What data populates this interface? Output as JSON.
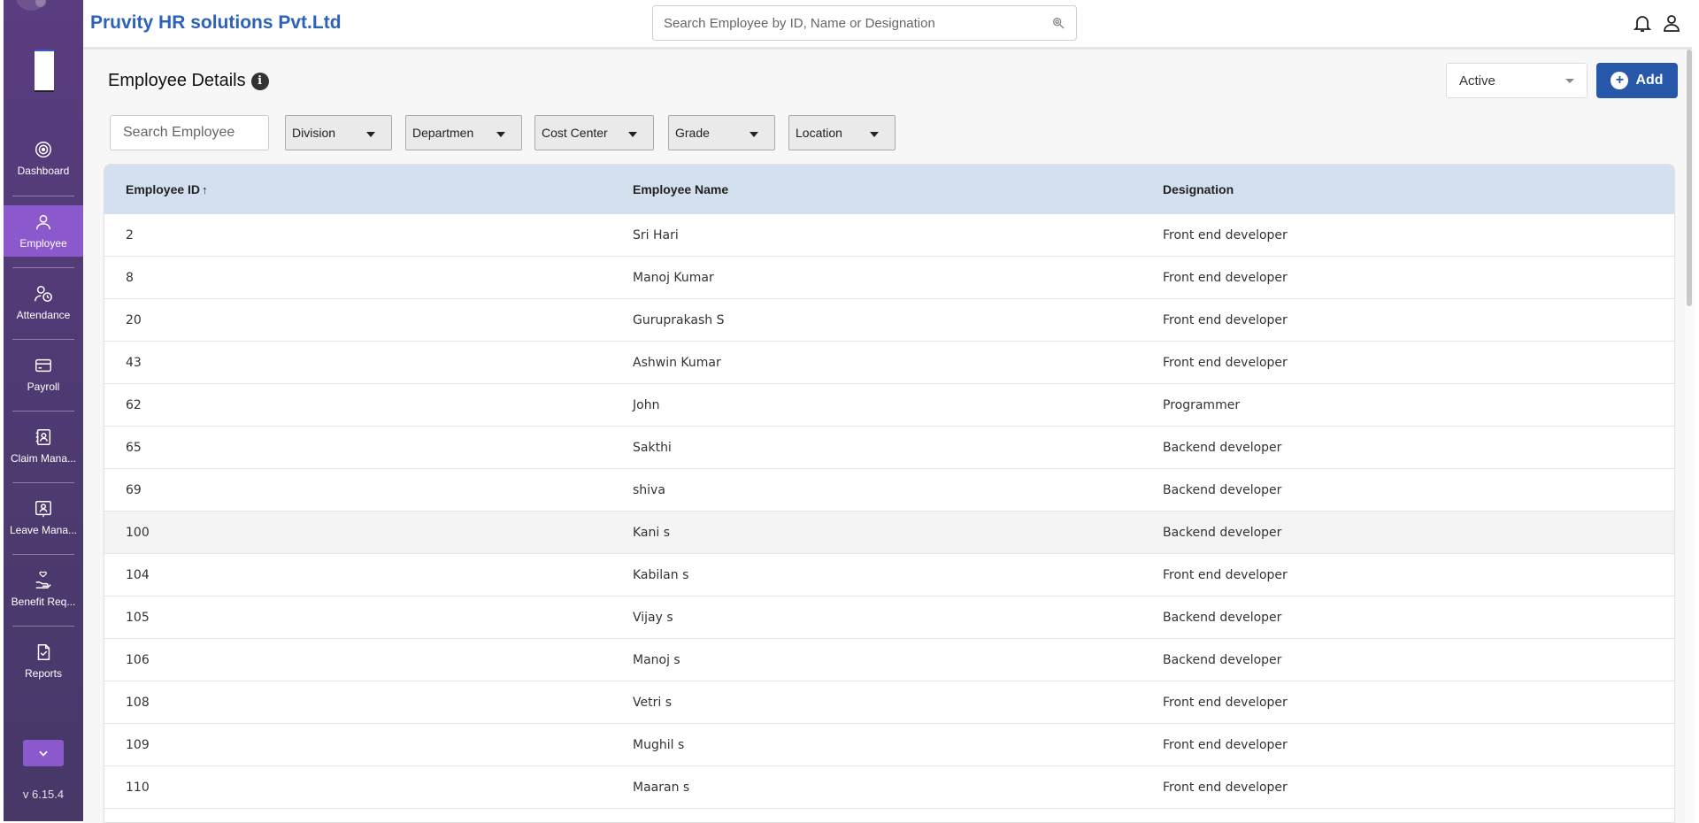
{
  "header": {
    "company": "Pruvity HR solutions Pvt.Ltd",
    "search_placeholder": "Search Employee by ID, Name or Designation"
  },
  "sidebar": {
    "items": [
      {
        "label": "Dashboard",
        "icon": "target-icon"
      },
      {
        "label": "Employee",
        "icon": "person-icon",
        "active": true
      },
      {
        "label": "Attendance",
        "icon": "person-clock-icon"
      },
      {
        "label": "Payroll",
        "icon": "card-icon"
      },
      {
        "label": "Claim Mana...",
        "icon": "contact-book-icon"
      },
      {
        "label": "Leave Mana...",
        "icon": "person-board-icon"
      },
      {
        "label": "Benefit Req...",
        "icon": "hand-heart-icon"
      },
      {
        "label": "Reports",
        "icon": "report-check-icon"
      }
    ],
    "version": "v 6.15.4"
  },
  "page": {
    "title": "Employee Details",
    "status": "Active",
    "add_label": "Add"
  },
  "filters": {
    "search_placeholder": "Search Employee",
    "division": "Division",
    "department": "Departmen",
    "cost_center": "Cost Center",
    "grade": "Grade",
    "location": "Location"
  },
  "table": {
    "headers": {
      "id": "Employee ID",
      "name": "Employee Name",
      "designation": "Designation"
    },
    "sort_indicator": "↑",
    "rows": [
      {
        "id": "2",
        "name": "Sri Hari",
        "designation": "Front end developer"
      },
      {
        "id": "8",
        "name": "Manoj Kumar",
        "designation": "Front end developer"
      },
      {
        "id": "20",
        "name": "Guruprakash S",
        "designation": "Front end developer"
      },
      {
        "id": "43",
        "name": "Ashwin Kumar",
        "designation": "Front end developer"
      },
      {
        "id": "62",
        "name": "John",
        "designation": "Programmer"
      },
      {
        "id": "65",
        "name": "Sakthi",
        "designation": "Backend developer"
      },
      {
        "id": "69",
        "name": "shiva",
        "designation": "Backend developer"
      },
      {
        "id": "100",
        "name": "Kani s",
        "designation": "Backend developer"
      },
      {
        "id": "104",
        "name": "Kabilan s",
        "designation": "Front end developer"
      },
      {
        "id": "105",
        "name": "Vijay s",
        "designation": "Backend developer"
      },
      {
        "id": "106",
        "name": "Manoj s",
        "designation": "Backend developer"
      },
      {
        "id": "108",
        "name": "Vetri s",
        "designation": "Front end developer"
      },
      {
        "id": "109",
        "name": "Mughil s",
        "designation": "Front end developer"
      },
      {
        "id": "110",
        "name": "Maaran s",
        "designation": "Front end developer"
      }
    ]
  }
}
